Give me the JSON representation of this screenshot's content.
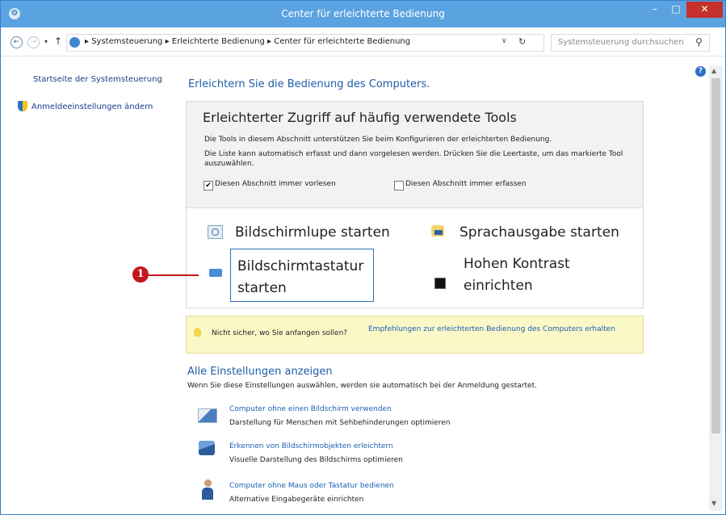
{
  "window": {
    "title": "Center für erleichterte Bedienung",
    "minimize": "–",
    "maximize": "□",
    "close": "✕"
  },
  "address_bar": {
    "back": "←",
    "forward": "→",
    "recent": "▾",
    "up": "↑",
    "path": "▸ Systemsteuerung  ▸  Erleichterte Bedienung  ▸  Center für erleichterte Bedienung",
    "dropdown": "∨",
    "refresh": "↻",
    "search_placeholder": "Systemsteuerung durchsuchen",
    "search_icon": "⚲"
  },
  "left_nav": {
    "home": "Startseite der Systemsteuerung",
    "login_settings": "Anmeldeeinstellungen ändern"
  },
  "main": {
    "heading": "Erleichtern Sie die Bedienung des Computers.",
    "panel": {
      "title": "Erleichterter Zugriff auf häufig verwendete Tools",
      "desc1": "Die Tools in diesem Abschnitt unterstützen Sie beim Konfigurieren der erleichterten Bedienung.",
      "desc2": "Die Liste kann automatisch erfasst und dann vorgelesen werden. Drücken Sie die Leertaste, um das markierte Tool auszuwählen.",
      "checkbox_read": {
        "label": "Diesen Abschnitt immer vorlesen",
        "mark": "✔",
        "checked": true
      },
      "checkbox_scan": {
        "label": "Diesen Abschnitt immer erfassen",
        "mark": "",
        "checked": false
      },
      "tools": {
        "magnifier": "Bildschirmlupe starten",
        "narrator": "Sprachausgabe starten",
        "keyboard": "Bildschirmtastatur starten",
        "contrast": "Hohen Kontrast einrichten"
      }
    },
    "hint": {
      "text": "Nicht sicher, wo Sie anfangen sollen?",
      "link": "Empfehlungen zur erleichterten Bedienung des Computers erhalten"
    },
    "all_settings": {
      "heading": "Alle Einstellungen anzeigen",
      "desc": "Wenn Sie diese Einstellungen auswählen, werden sie automatisch bei der Anmeldung gestartet.",
      "items": [
        {
          "link": "Computer ohne einen Bildschirm verwenden",
          "desc": "Darstellung für Menschen mit Sehbehinderungen optimieren"
        },
        {
          "link": "Erkennen von Bildschirmobjekten erleichtern",
          "desc": "Visuelle Darstellung des Bildschirms optimieren"
        },
        {
          "link": "Computer ohne Maus oder Tastatur bedienen",
          "desc": "Alternative Eingabegeräte einrichten"
        }
      ]
    }
  },
  "help": "?",
  "scrollbar": {
    "up": "▲",
    "down": "▼"
  },
  "annotation": {
    "number": "1"
  }
}
